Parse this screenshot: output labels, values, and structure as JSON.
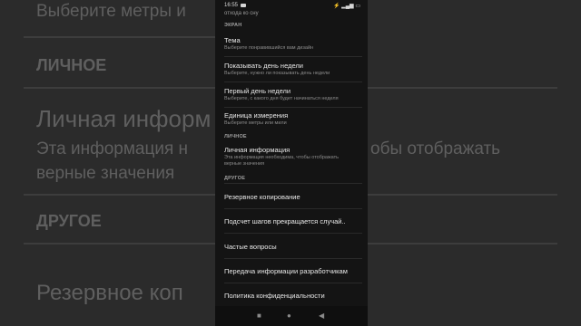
{
  "status": {
    "time": "16:55",
    "icons": "⚡ ▂▄▆ ▭"
  },
  "top_subtitle": "отхода ко сну",
  "sections": {
    "screen": "ЭКРАН",
    "personal": "ЛИЧНОЕ",
    "other": "ДРУГОЕ"
  },
  "items": {
    "theme": {
      "title": "Тема",
      "desc": "Выберите понравившийся вам дизайн"
    },
    "weekday": {
      "title": "Показывать день недели",
      "desc": "Выберите, нужно ли показывать день недели"
    },
    "first_day": {
      "title": "Первый день недели",
      "desc": "Выберите, с какого дня будет начинаться неделя"
    },
    "units": {
      "title": "Единица измерения",
      "desc": "Выберите метры или мили"
    },
    "personal_info": {
      "title": "Личная информация",
      "desc": "Эта информация необходима, чтобы отображать верные значения"
    },
    "backup": {
      "title": "Резервное копирование"
    },
    "step_counting": {
      "title": "Подсчет шагов прекращается случай.."
    },
    "faq": {
      "title": "Частые вопросы"
    },
    "send_info": {
      "title": "Передача информации разработчикам"
    },
    "privacy": {
      "title": "Политика конфиденциальности"
    }
  },
  "navbar": {
    "recents": "■",
    "home": "●",
    "back": "◀"
  },
  "background": {
    "top_text": "Выберите метры и",
    "personal_heading": "ЛИЧНОЕ",
    "personal_title": "Личная информ",
    "personal_desc_1": "Эта информация н",
    "personal_desc_right": "обы отображать",
    "personal_desc_2": "верные значения",
    "other_heading": "ДРУГОЕ",
    "backup_title": "Резервное коп"
  }
}
